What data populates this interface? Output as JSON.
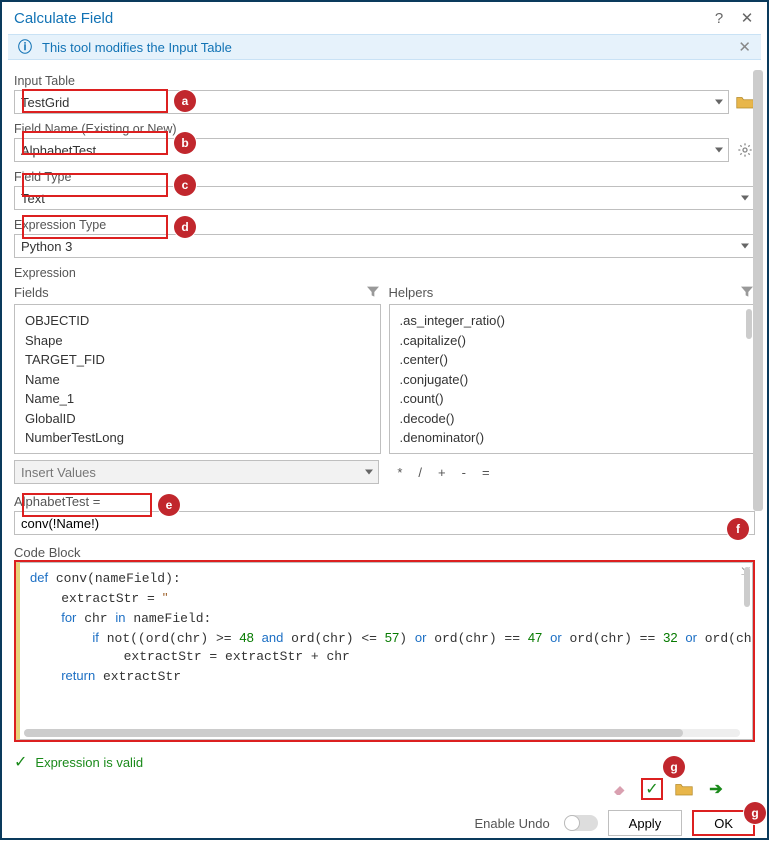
{
  "title": "Calculate Field",
  "infobar": {
    "text": "This tool modifies the Input Table"
  },
  "inputs": {
    "input_table": {
      "label": "Input Table",
      "value": "TestGrid"
    },
    "field_name": {
      "label": "Field Name (Existing or New)",
      "value": "AlphabetTest"
    },
    "field_type": {
      "label": "Field Type",
      "value": "Text"
    },
    "expr_type": {
      "label": "Expression Type",
      "value": "Python 3"
    }
  },
  "expression": {
    "label": "Expression",
    "fields_header": "Fields",
    "helpers_header": "Helpers",
    "fields": [
      "OBJECTID",
      "Shape",
      "TARGET_FID",
      "Name",
      "Name_1",
      "GlobalID",
      "NumberTestLong"
    ],
    "helpers": [
      ".as_integer_ratio()",
      ".capitalize()",
      ".center()",
      ".conjugate()",
      ".count()",
      ".decode()",
      ".denominator()"
    ],
    "insert_values": "Insert Values",
    "ops": [
      "*",
      "/",
      "+",
      "-",
      "="
    ],
    "equals_label": "AlphabetTest =",
    "expr_value": "conv(!Name!)"
  },
  "codeblock": {
    "label": "Code Block",
    "code_plain": "def conv(nameField):\n    extractStr = ''\n    for chr in nameField:\n        if not((ord(chr) >= 48 and ord(chr) <= 57) or ord(chr) == 47 or ord(chr) == 32 or ord(chr) ==\n            extractStr = extractStr + chr\n    return extractStr"
  },
  "status": {
    "valid_text": "Expression is valid"
  },
  "footer": {
    "enable_undo": "Enable Undo",
    "apply": "Apply",
    "ok": "OK"
  },
  "callouts": {
    "a": "a",
    "b": "b",
    "c": "c",
    "d": "d",
    "e": "e",
    "f": "f",
    "g": "g",
    "g2": "g"
  },
  "icons": {
    "help": "?",
    "close": "✕",
    "info": "ⓘ",
    "filter": "filter",
    "folder": "folder",
    "gear": "gear",
    "eraser": "eraser",
    "check": "✓",
    "load": "load",
    "run": "➔"
  }
}
